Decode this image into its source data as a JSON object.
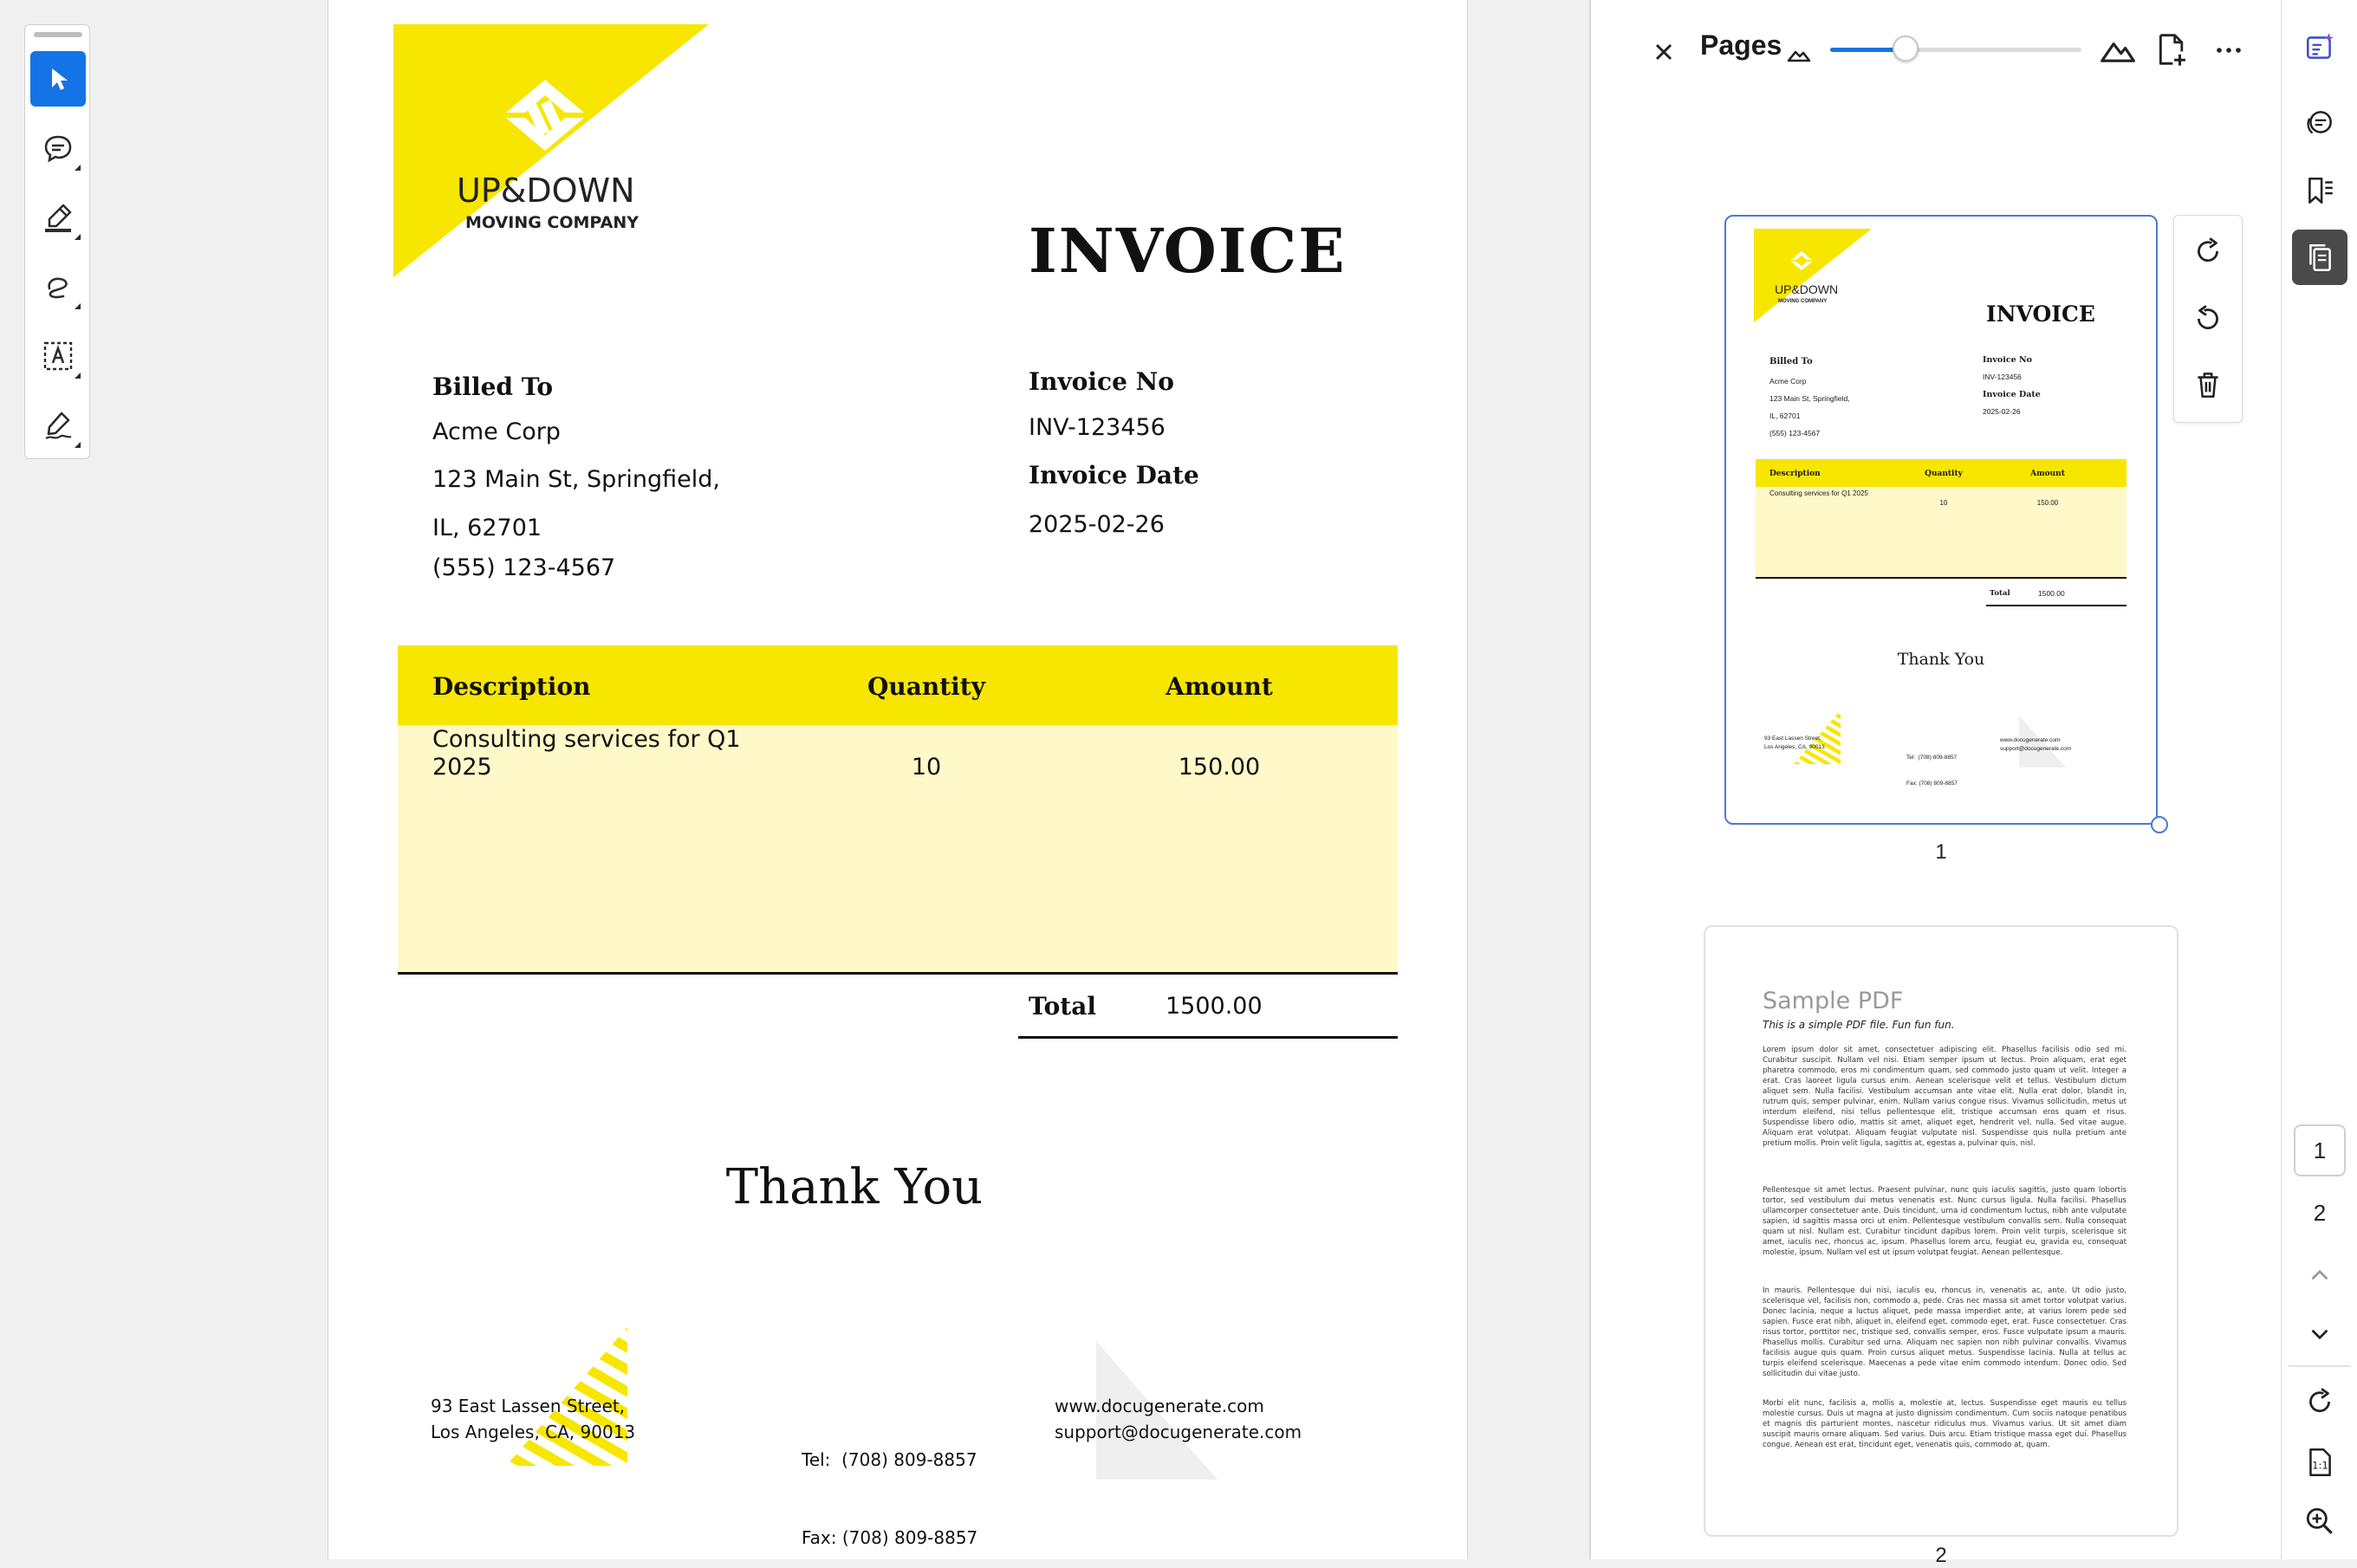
{
  "tools": [
    {
      "name": "select",
      "icon": "cursor-arrow-icon",
      "active": true
    },
    {
      "name": "comment",
      "icon": "comment-add-icon"
    },
    {
      "name": "highlight",
      "icon": "highlighter-pen-icon"
    },
    {
      "name": "draw",
      "icon": "freehand-draw-icon"
    },
    {
      "name": "text",
      "icon": "text-box-icon"
    },
    {
      "name": "sign",
      "icon": "signature-pen-icon"
    }
  ],
  "invoice": {
    "brand_name": "UP&DOWN",
    "brand_tagline": "MOVING COMPANY",
    "title": "INVOICE",
    "billed_to_label": "Billed To",
    "billed_to": [
      "Acme Corp",
      "123 Main St, Springfield,",
      "IL, 62701",
      "(555) 123-4567"
    ],
    "invoice_no_label": "Invoice No",
    "invoice_no": "INV-123456",
    "invoice_date_label": "Invoice Date",
    "invoice_date": "2025-02-26",
    "table": {
      "headers": [
        "Description",
        "Quantity",
        "Amount"
      ],
      "rows": [
        [
          "Consulting services for Q1 2025",
          "10",
          "150.00"
        ]
      ]
    },
    "total_label": "Total",
    "total_value": "1500.00",
    "thank_you": "Thank You",
    "address": [
      "93 East Lassen Street,",
      "Los Angeles, CA, 90013"
    ],
    "phone": [
      "Tel:  (708) 809-8857",
      "Fax: (708) 809-8857"
    ],
    "web": [
      "www.docugenerate.com",
      "support@docugenerate.com"
    ],
    "colors": {
      "accent": "#f7e600",
      "accent_light": "#fff8c8"
    }
  },
  "pages_panel": {
    "title": "Pages",
    "zoom_level": 0.3,
    "close_icon": "close-icon",
    "thumb_actions": [
      "rotate-clockwise-icon",
      "rotate-counterclockwise-icon",
      "trash-icon"
    ],
    "thumbnails": [
      {
        "page_label": "1"
      },
      {
        "page_label": "2",
        "title": "Sample PDF",
        "subtitle": "This is a simple PDF file. Fun fun fun.",
        "paragraphs": [
          "Lorem ipsum dolor sit amet, consectetuer adipiscing elit. Phasellus facilisis odio sed mi. Curabitur suscipit. Nullam vel nisi. Etiam semper ipsum ut lectus. Proin aliquam, erat eget pharetra commodo, eros mi condimentum quam, sed commodo justo quam ut velit. Integer a erat. Cras laoreet ligula cursus enim. Aenean scelerisque velit et tellus. Vestibulum dictum aliquet sem. Nulla facilisi. Vestibulum accumsan ante vitae elit. Nulla erat dolor, blandit in, rutrum quis, semper pulvinar, enim. Nullam varius congue risus. Vivamus sollicitudin, metus ut interdum eleifend, nisi tellus pellentesque elit, tristique accumsan eros quam et risus. Suspendisse libero odio, mattis sit amet, aliquet eget, hendrerit vel, nulla. Sed vitae augue. Aliquam erat volutpat. Aliquam feugiat vulputate nisl. Suspendisse quis nulla pretium ante pretium mollis. Proin velit ligula, sagittis at, egestas a, pulvinar quis, nisl.",
          "Pellentesque sit amet lectus. Praesent pulvinar, nunc quis iaculis sagittis, justo quam lobortis tortor, sed vestibulum dui metus venenatis est. Nunc cursus ligula. Nulla facilisi. Phasellus ullamcorper consectetuer ante. Duis tincidunt, urna id condimentum luctus, nibh ante vulputate sapien, id sagittis massa orci ut enim. Pellentesque vestibulum convallis sem. Nulla consequat quam ut nisl. Nullam est. Curabitur tincidunt dapibus lorem. Proin velit turpis, scelerisque sit amet, iaculis nec, rhoncus ac, ipsum. Phasellus lorem arcu, feugiat eu, gravida eu, consequat molestie, ipsum. Nullam vel est ut ipsum volutpat feugiat. Aenean pellentesque.",
          "In mauris. Pellentesque dui nisi, iaculis eu, rhoncus in, venenatis ac, ante. Ut odio justo, scelerisque vel, facilisis non, commodo a, pede. Cras nec massa sit amet tortor volutpat varius. Donec lacinia, neque a luctus aliquet, pede massa imperdiet ante, at varius lorem pede sed sapien. Fusce erat nibh, aliquet in, eleifend eget, commodo eget, erat. Fusce consectetuer. Cras risus tortor, porttitor nec, tristique sed, convallis semper, eros. Fusce vulputate ipsum a mauris. Phasellus mollis. Curabitur sed urna. Aliquam nec sapien non nibh pulvinar convallis. Vivamus facilisis augue quis quam. Proin cursus aliquet metus. Suspendisse lacinia. Nulla at tellus ac turpis eleifend scelerisque. Maecenas a pede vitae enim commodo interdum. Donec odio. Sed sollicitudin dui vitae justo.",
          "Morbi elit nunc, facilisis a, mollis a, molestie at, lectus. Suspendisse eget mauris eu tellus molestie cursus. Duis ut magna at justo dignissim condimentum. Cum sociis natoque penatibus et magnis dis parturient montes, nascetur ridiculus mus. Vivamus varius. Ut sit amet diam suscipit mauris ornare aliquam. Sed varius. Duis arcu. Etiam tristique massa eget dui. Phasellus congue. Aenean est erat, tincidunt eget, venenatis quis, commodo at, quam."
        ]
      }
    ]
  },
  "right_rail": {
    "tools": [
      "edit-ai-icon",
      "comments-icon",
      "bookmarks-icon",
      "pages-icon"
    ],
    "pages": [
      "1",
      "2"
    ],
    "bottom": [
      "page-up-icon",
      "page-down-icon",
      "refresh-icon",
      "actual-size-icon",
      "zoom-in-icon"
    ]
  }
}
